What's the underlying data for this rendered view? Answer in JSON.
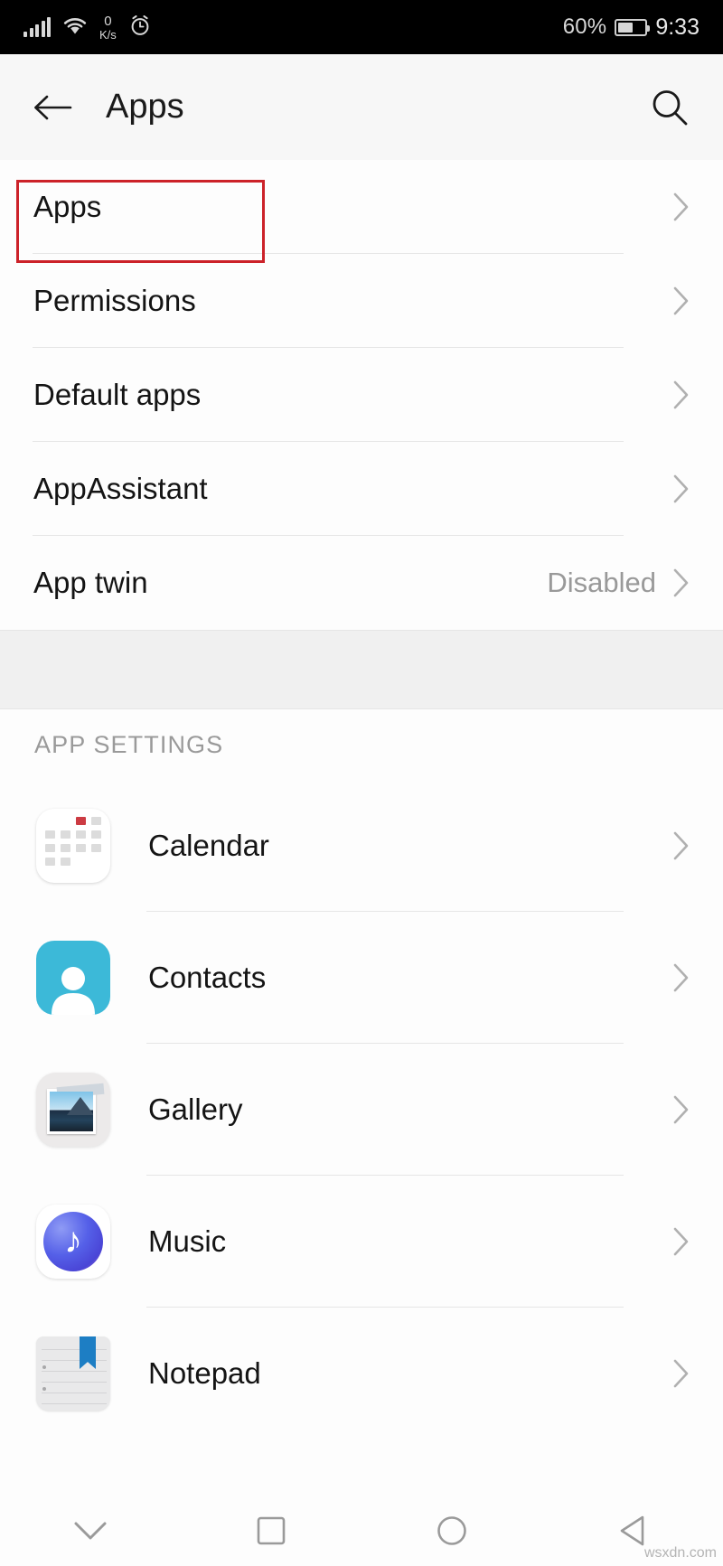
{
  "status_bar": {
    "network_speed_value": "0",
    "network_speed_unit": "K/s",
    "battery_percent": "60%",
    "clock": "9:33",
    "icons": [
      "signal-bars-icon",
      "wifi-icon",
      "alarm-clock-icon",
      "battery-saver-icon"
    ]
  },
  "app_bar": {
    "title": "Apps",
    "back_icon": "back-arrow-icon",
    "search_icon": "search-icon"
  },
  "settings_list": [
    {
      "label": "Apps",
      "value": "",
      "highlighted": true
    },
    {
      "label": "Permissions",
      "value": "",
      "highlighted": false
    },
    {
      "label": "Default apps",
      "value": "",
      "highlighted": false
    },
    {
      "label": "AppAssistant",
      "value": "",
      "highlighted": false
    },
    {
      "label": "App twin",
      "value": "Disabled",
      "highlighted": false
    }
  ],
  "app_settings": {
    "header": "APP SETTINGS",
    "items": [
      {
        "name": "Calendar",
        "icon": "calendar-app-icon"
      },
      {
        "name": "Contacts",
        "icon": "contacts-app-icon"
      },
      {
        "name": "Gallery",
        "icon": "gallery-app-icon"
      },
      {
        "name": "Music",
        "icon": "music-app-icon"
      },
      {
        "name": "Notepad",
        "icon": "notepad-app-icon"
      }
    ]
  },
  "nav_bar": {
    "buttons": [
      "chevron-down-icon",
      "recents-square-icon",
      "home-circle-icon",
      "back-triangle-icon"
    ]
  },
  "watermark": "wsxdn.com",
  "colors": {
    "highlight_box": "#cc2229",
    "status_bar_bg": "#000000",
    "app_bar_bg": "#f7f7f7",
    "divider": "#e6e6e6",
    "secondary_text": "#999999",
    "contacts_icon": "#3cb9d8",
    "calendar_icon": "#cc3b43"
  }
}
